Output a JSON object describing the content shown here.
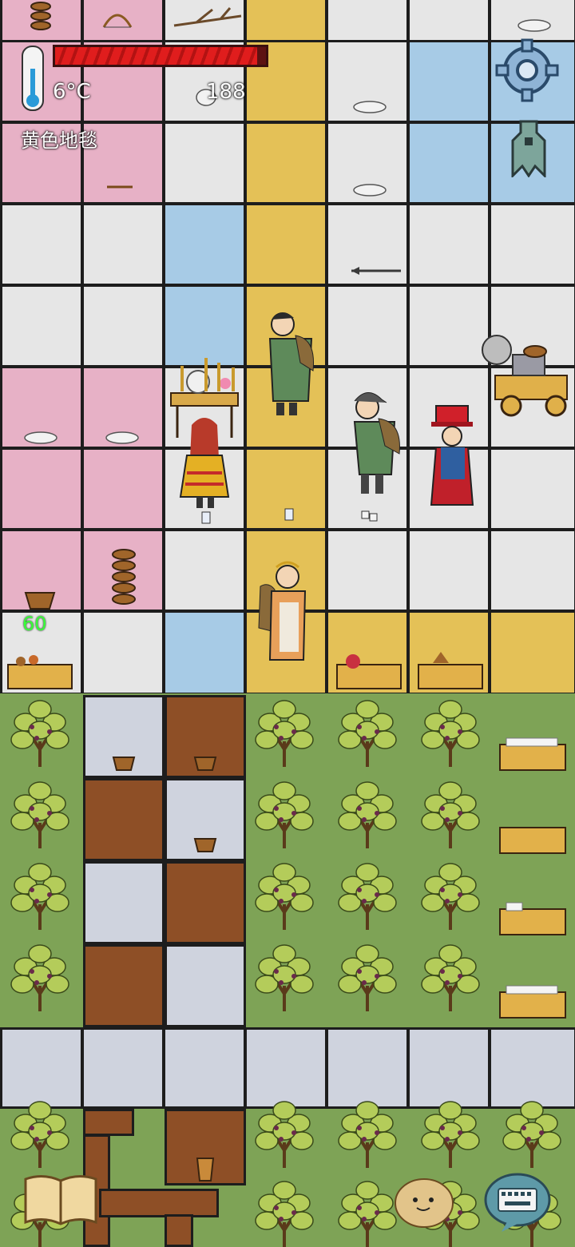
{
  "hud": {
    "temperature": "6°C",
    "food_count": "188",
    "tile_name": "黄色地毯",
    "player_age": "60",
    "health_fraction": 0.96
  },
  "icons": {
    "settings": "gear-icon",
    "tech": "coin-icon",
    "book": "book-icon",
    "emote": "potato-face-icon",
    "keyboard": "keyboard-icon",
    "thermometer": "thermometer-icon",
    "food": "food-pip-icon"
  },
  "colors": {
    "carpet_pink": "#e7b1c6",
    "carpet_yellow": "#e4c157",
    "carpet_blue": "#a7cbe6",
    "carpet_gray": "#e6e6e6",
    "stone": "#cfd3de",
    "wood_floor": "#8e4f26",
    "grass": "#7ea356",
    "health_red": "#e01d1d",
    "age_green": "#39ff39"
  }
}
